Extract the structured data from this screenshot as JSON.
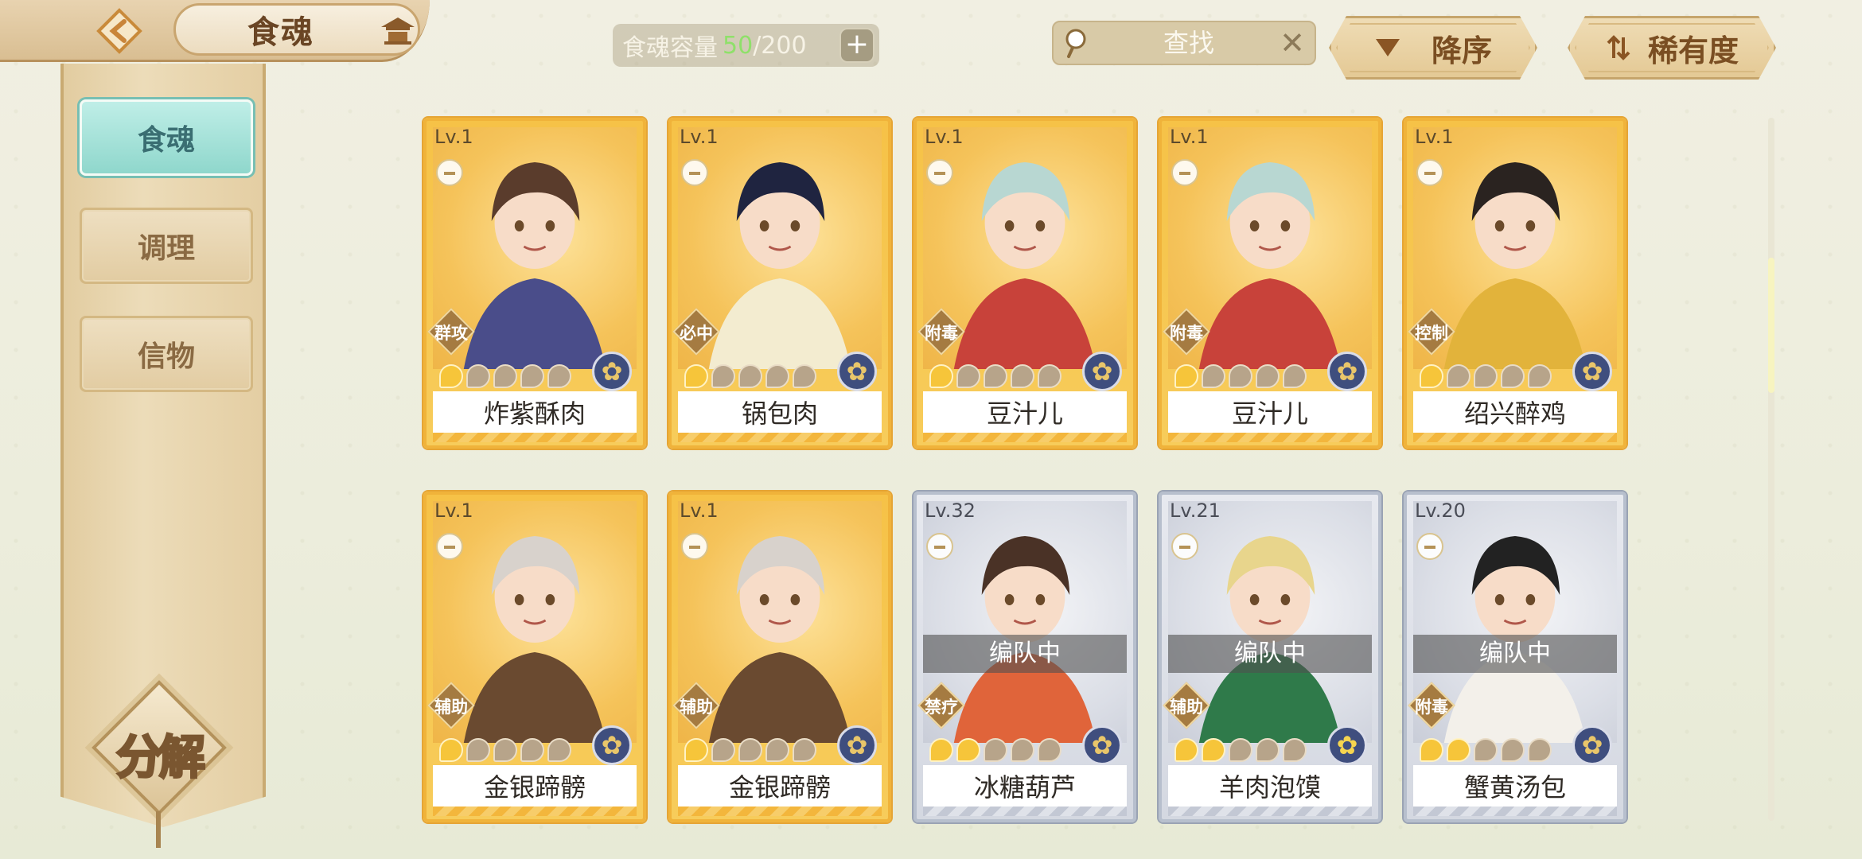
{
  "header": {
    "title": "食魂",
    "capacity_label": "食魂容量",
    "capacity_used": "50",
    "capacity_total": "/200",
    "search_placeholder": "查找",
    "sort_order_label": "降序",
    "sort_key_label": "稀有度"
  },
  "sidebar": {
    "items": [
      {
        "label": "食魂",
        "active": true
      },
      {
        "label": "调理",
        "active": false
      },
      {
        "label": "信物",
        "active": false
      }
    ],
    "decompose_label": "分解"
  },
  "cards": [
    {
      "level": "Lv.1",
      "name": "炸紫酥肉",
      "role": "群攻",
      "stars": 1,
      "rarity": "gold",
      "team": ""
    },
    {
      "level": "Lv.1",
      "name": "锅包肉",
      "role": "必中",
      "stars": 1,
      "rarity": "gold",
      "team": ""
    },
    {
      "level": "Lv.1",
      "name": "豆汁儿",
      "role": "附毒",
      "stars": 1,
      "rarity": "gold",
      "team": ""
    },
    {
      "level": "Lv.1",
      "name": "豆汁儿",
      "role": "附毒",
      "stars": 1,
      "rarity": "gold",
      "team": ""
    },
    {
      "level": "Lv.1",
      "name": "绍兴醉鸡",
      "role": "控制",
      "stars": 1,
      "rarity": "gold",
      "team": ""
    },
    {
      "level": "Lv.1",
      "name": "金银蹄髈",
      "role": "辅助",
      "stars": 1,
      "rarity": "gold",
      "team": ""
    },
    {
      "level": "Lv.1",
      "name": "金银蹄髈",
      "role": "辅助",
      "stars": 1,
      "rarity": "gold",
      "team": ""
    },
    {
      "level": "Lv.32",
      "name": "冰糖葫芦",
      "role": "禁疗",
      "stars": 2,
      "rarity": "silver",
      "team": "编队中"
    },
    {
      "level": "Lv.21",
      "name": "羊肉泡馍",
      "role": "辅助",
      "stars": 2,
      "rarity": "silver",
      "team": "编队中"
    },
    {
      "level": "Lv.20",
      "name": "蟹黄汤包",
      "role": "附毒",
      "stars": 2,
      "rarity": "silver",
      "team": "编队中"
    }
  ],
  "colors": {
    "gold_card": "#f6c247",
    "silver_card": "#d4d8e1",
    "active_tab": "#8fd7cc",
    "capacity_used": "#8fe06a"
  },
  "icons": {
    "back": "back-arrow-icon",
    "home": "pavilion-icon",
    "search": "magnifier-icon",
    "clear": "close-icon",
    "sort_order": "triangle-down-icon",
    "sort_key": "sort-arrows-icon",
    "element": "flower-emblem-icon",
    "star": "flame-star-icon",
    "lock": "lock-icon"
  }
}
